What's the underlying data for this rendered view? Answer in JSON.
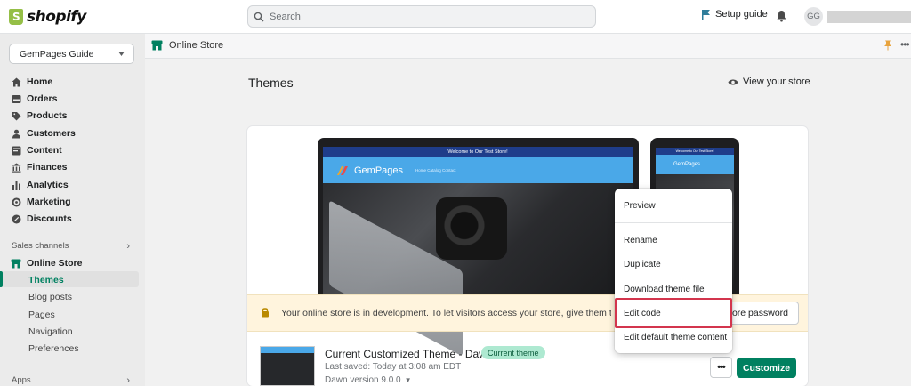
{
  "topbar": {
    "logo_text": "shopify",
    "search_placeholder": "Search",
    "setup_guide": "Setup guide",
    "avatar_initials": "GG"
  },
  "sidebar": {
    "store_name": "GemPages Guide",
    "items": [
      {
        "label": "Home",
        "icon": "home-icon"
      },
      {
        "label": "Orders",
        "icon": "orders-icon"
      },
      {
        "label": "Products",
        "icon": "tag-icon"
      },
      {
        "label": "Customers",
        "icon": "person-icon"
      },
      {
        "label": "Content",
        "icon": "content-icon"
      },
      {
        "label": "Finances",
        "icon": "bank-icon"
      },
      {
        "label": "Analytics",
        "icon": "bar-chart-icon"
      },
      {
        "label": "Marketing",
        "icon": "target-icon"
      },
      {
        "label": "Discounts",
        "icon": "discount-icon"
      }
    ],
    "sales_channels_label": "Sales channels",
    "online_store": "Online Store",
    "online_store_sub": [
      "Themes",
      "Blog posts",
      "Pages",
      "Navigation",
      "Preferences"
    ],
    "apps_label": "Apps"
  },
  "breadcrumb": {
    "title": "Online Store"
  },
  "page": {
    "title": "Themes",
    "view_store": "View your store"
  },
  "preview": {
    "promo_text": "Welcome to Our Test Store!",
    "brand": "GemPages",
    "nav_links": "Home   Catalog   Contact"
  },
  "banner": {
    "text": "Your online store is in development. To let visitors access your store, give them the password",
    "button": "store password"
  },
  "theme": {
    "name": "Current Customized Theme - Dawn",
    "badge": "Current theme",
    "last_saved": "Last saved: Today at 3:08 am EDT",
    "version": "Dawn version 9.0.0",
    "more_label": "•••",
    "customize": "Customize"
  },
  "menu": {
    "items": [
      "Preview",
      "Rename",
      "Duplicate",
      "Download theme file",
      "Edit code",
      "Edit default theme content"
    ]
  },
  "colors": {
    "accent": "#008060",
    "highlight": "#d3354d"
  }
}
